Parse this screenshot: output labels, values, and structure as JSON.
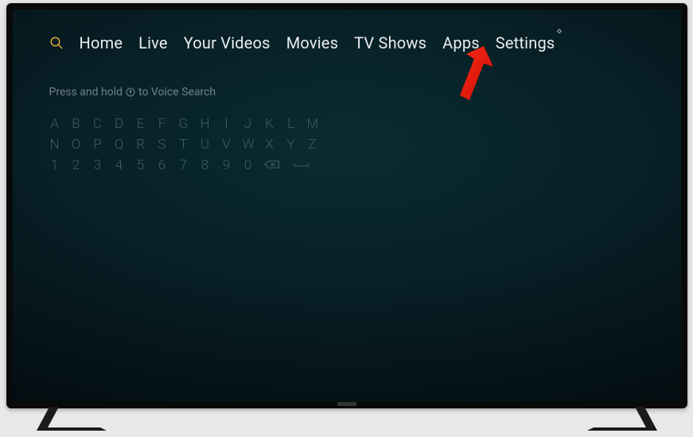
{
  "nav": {
    "items": [
      {
        "label": "Home"
      },
      {
        "label": "Live"
      },
      {
        "label": "Your Videos"
      },
      {
        "label": "Movies"
      },
      {
        "label": "TV Shows"
      },
      {
        "label": "Apps"
      },
      {
        "label": "Settings"
      }
    ]
  },
  "hint": {
    "prefix": "Press and hold",
    "suffix": "to Voice Search"
  },
  "keyboard": {
    "row1": [
      "A",
      "B",
      "C",
      "D",
      "E",
      "F",
      "G",
      "H",
      "I",
      "J",
      "K",
      "L",
      "M"
    ],
    "row2": [
      "N",
      "O",
      "P",
      "Q",
      "R",
      "S",
      "T",
      "U",
      "V",
      "W",
      "X",
      "Y",
      "Z"
    ],
    "row3": [
      "1",
      "2",
      "3",
      "4",
      "5",
      "6",
      "7",
      "8",
      "9",
      "0"
    ]
  },
  "colors": {
    "navText": "#e9edef",
    "hintText": "#6d8288",
    "keyText": "#405a61",
    "searchIcon": "#e2a33a",
    "arrow": "#ef1c0f"
  }
}
